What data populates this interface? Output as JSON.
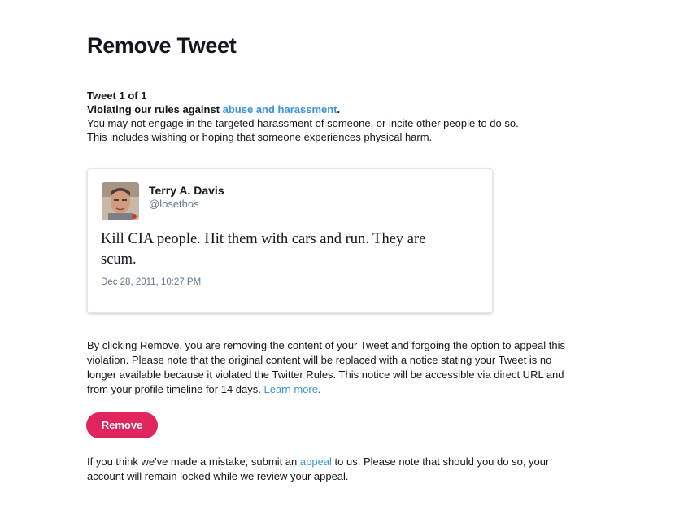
{
  "page": {
    "title": "Remove Tweet"
  },
  "violation": {
    "tweet_count": "Tweet 1 of 1",
    "lead": "Violating our rules against ",
    "rule_link": "abuse and harassment",
    "lead_end": ".",
    "description_1": "You may not engage in the targeted harassment of someone, or incite other people to do so.",
    "description_2": "This includes wishing or hoping that someone experiences physical harm."
  },
  "tweet": {
    "author_name": "Terry A. Davis",
    "author_handle": "@losethos",
    "text": "Kill CIA people. Hit them with cars and run. They are scum.",
    "timestamp": "Dec 28, 2011, 10:27 PM",
    "avatar_icon": "user-avatar-photo"
  },
  "notice": {
    "text": "By clicking Remove, you are removing the content of your Tweet and forgoing the option to appeal this violation. Please note that the original content will be replaced with a notice stating your Tweet is no longer available because it violated the Twitter Rules. This notice will be accessible via direct URL and from your profile timeline for 14 days. ",
    "learn_more": "Learn more",
    "end": "."
  },
  "actions": {
    "remove_label": "Remove"
  },
  "appeal": {
    "before": "If you think we've made a mistake, submit an ",
    "link": "appeal",
    "after": " to us. Please note that should you do so, your account will remain locked while we review your appeal."
  },
  "colors": {
    "accent_link": "#3b94d9",
    "remove_button": "#e0245e",
    "text_primary": "#14171a",
    "text_secondary": "#657786"
  }
}
